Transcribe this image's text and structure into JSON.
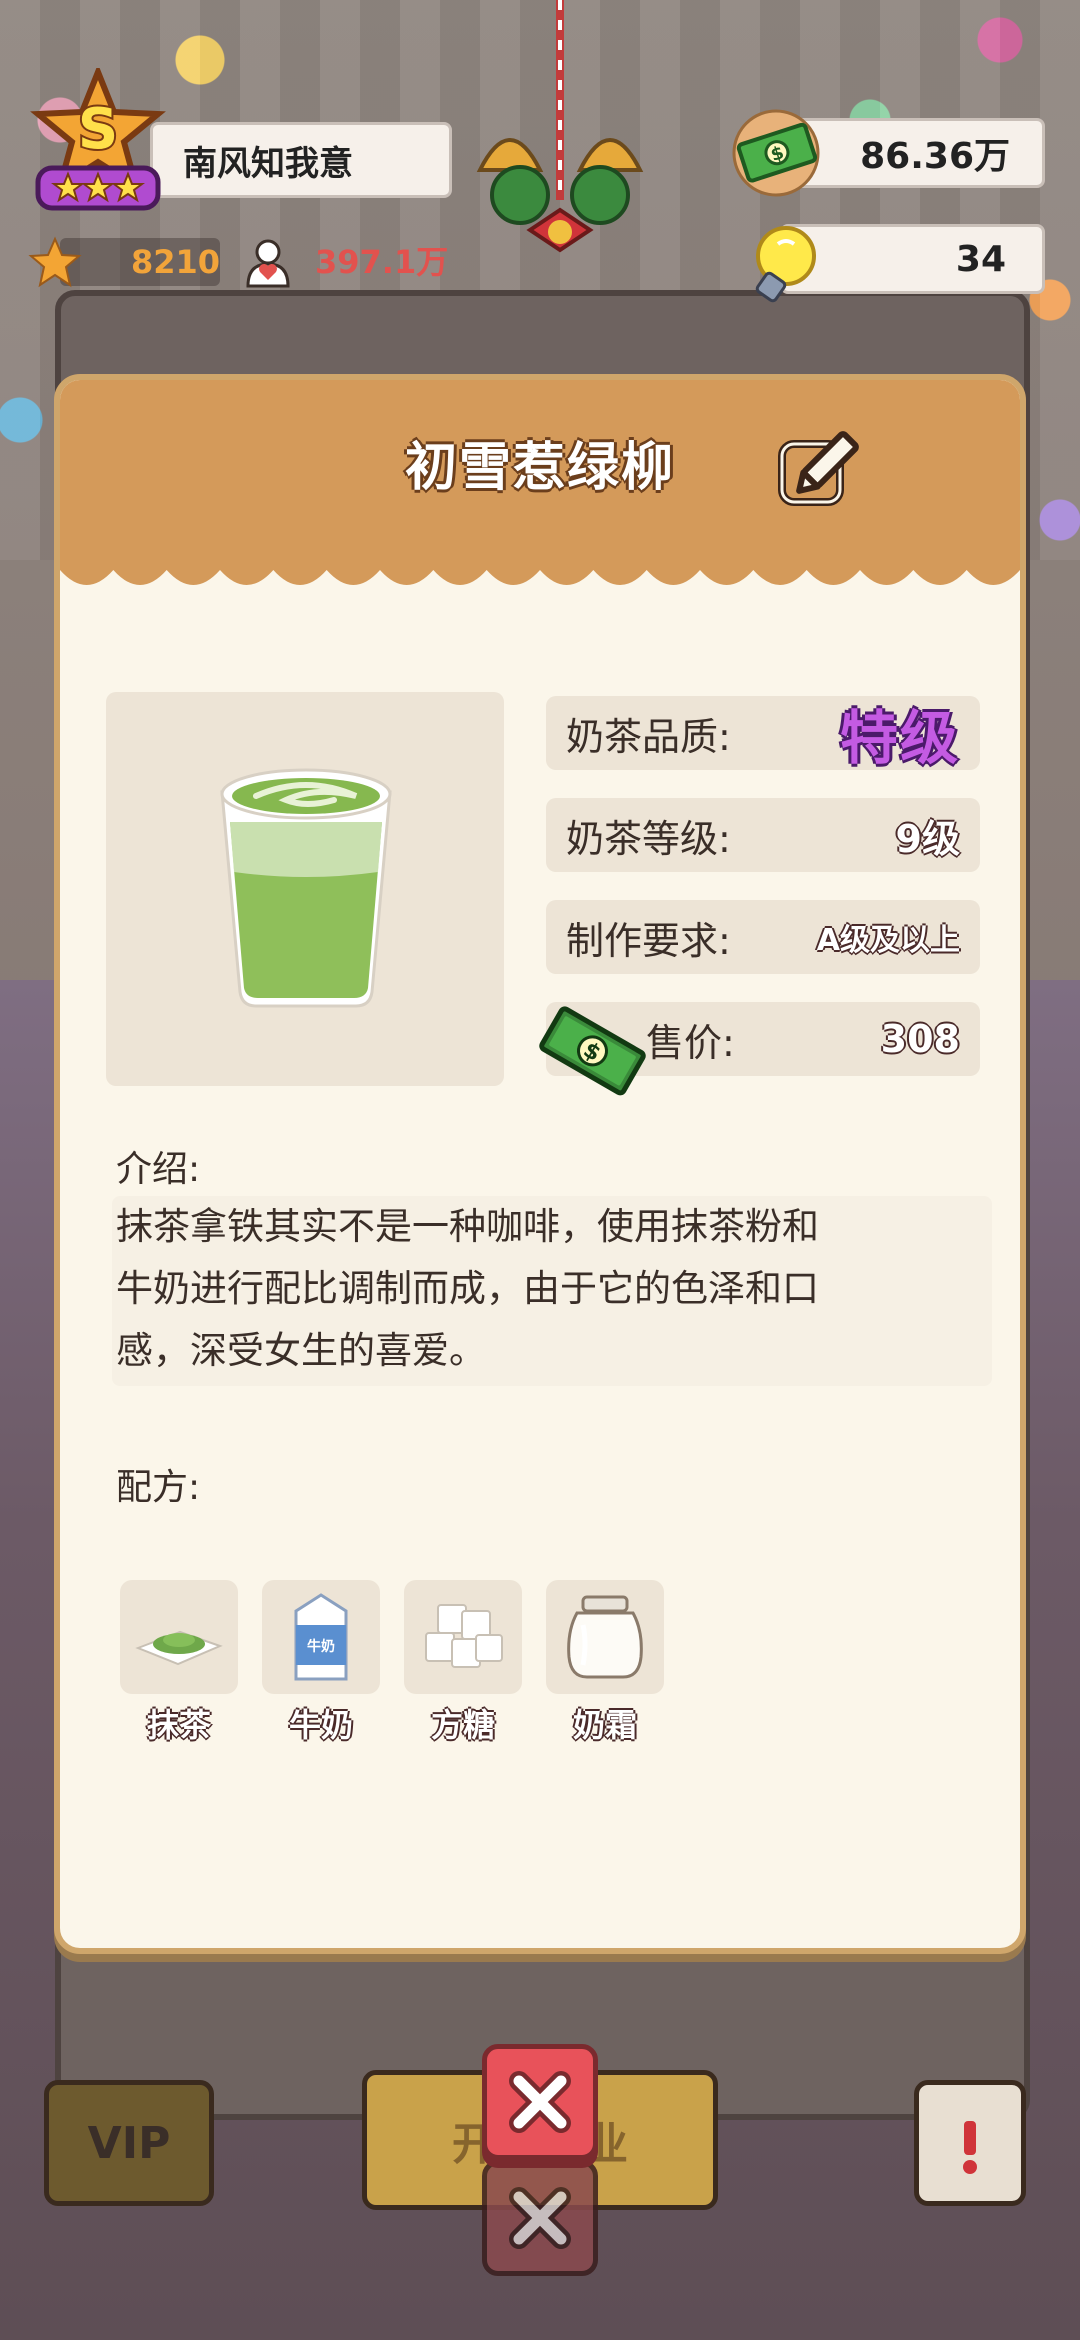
{
  "hud": {
    "player_name": "南风知我意",
    "rank_letter": "S",
    "stars": "8210",
    "fans": "397.1万",
    "money": "86.36万",
    "ideas": "34"
  },
  "modal": {
    "title": "初雪惹绿柳",
    "info": [
      {
        "label": "奶茶品质:",
        "value": "特级"
      },
      {
        "label": "奶茶等级:",
        "value": "9级"
      },
      {
        "label": "制作要求:",
        "value": "A级及以上"
      },
      {
        "label": "售价:",
        "value": "308"
      }
    ],
    "intro_label": "介绍:",
    "intro_lines": [
      "抹茶拿铁其实不是一种咖啡，使用抹茶粉和",
      "牛奶进行配比调制而成，由于它的色泽和口",
      "感，深受女生的喜爱。"
    ],
    "recipe_label": "配方:",
    "ingredients": [
      {
        "name": "抹茶",
        "icon": "matcha-powder-icon"
      },
      {
        "name": "牛奶",
        "icon": "milk-carton-icon",
        "carton_text": "牛奶"
      },
      {
        "name": "方糖",
        "icon": "sugar-cubes-icon"
      },
      {
        "name": "奶霜",
        "icon": "cream-jar-icon"
      }
    ]
  },
  "background": {
    "vip_label": "VIP",
    "obscured_button_text": "开张营业"
  },
  "colors": {
    "header": "#d49a5a",
    "panel": "#fbf6ea",
    "grade": "#c45be3",
    "close": "#e8525a"
  }
}
